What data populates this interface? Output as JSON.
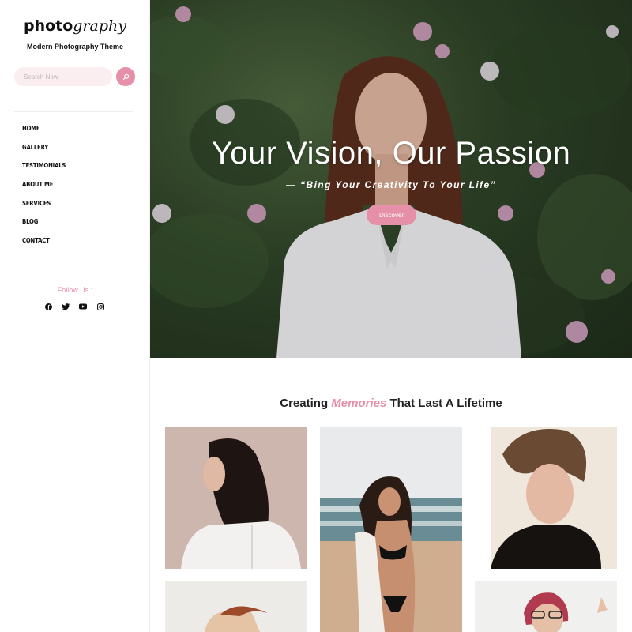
{
  "brand": {
    "logo_bold": "photo",
    "logo_italic": "graphy",
    "tagline": "Modern Photography Theme"
  },
  "search": {
    "placeholder": "Search Now"
  },
  "nav": {
    "items": [
      "HOME",
      "GALLERY",
      "TESTIMONIALS",
      "ABOUT ME",
      "SERVICES",
      "BLOG",
      "CONTACT"
    ]
  },
  "follow": {
    "label": "Follow Us :",
    "icons": [
      "facebook-icon",
      "twitter-icon",
      "youtube-icon",
      "instagram-icon"
    ]
  },
  "hero": {
    "title": "Your Vision, Our Passion",
    "subtitle": "— “Bing Your Creativity To Your Life”",
    "button": "Discover"
  },
  "section": {
    "title_prefix": "Creating ",
    "title_accent": "Memories",
    "title_suffix": " That Last A Lifetime"
  },
  "colors": {
    "accent": "#e58fa8",
    "search_bg": "#fbeef1"
  }
}
